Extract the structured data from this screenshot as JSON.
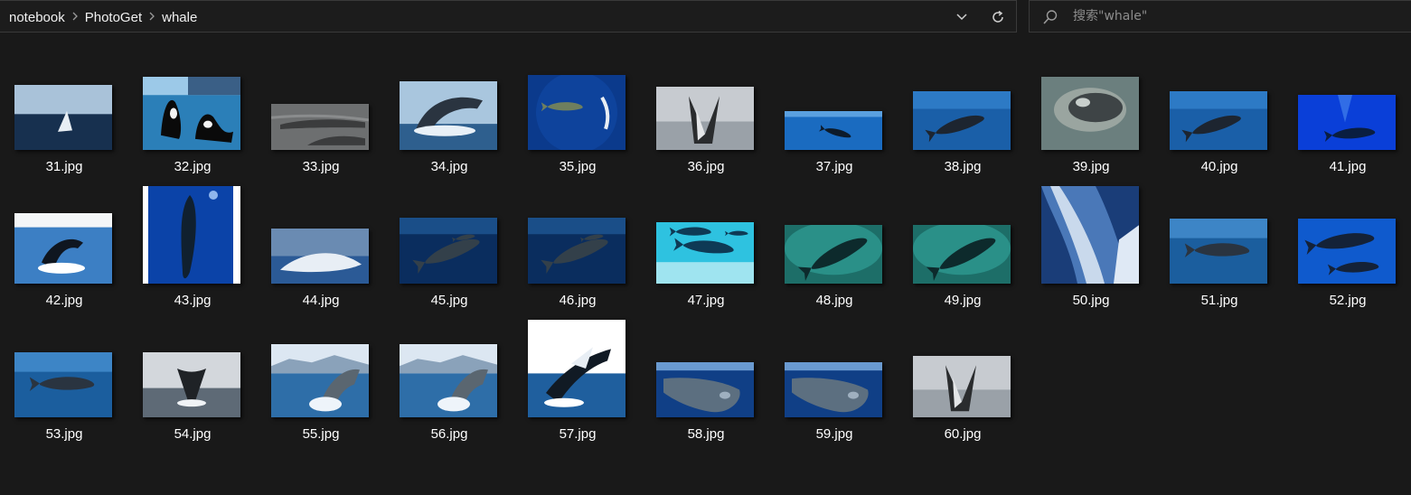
{
  "breadcrumb": [
    "notebook",
    "PhotoGet",
    "whale"
  ],
  "search": {
    "placeholder": "搜索\"whale\""
  },
  "icons": {
    "separator": "chevron-right-icon",
    "dropdown": "chevron-down-icon",
    "refresh": "refresh-icon",
    "search": "search-icon"
  },
  "files": [
    {
      "name": "31.jpg",
      "scene": "breach-sea",
      "w": 108,
      "h": 72
    },
    {
      "name": "32.jpg",
      "scene": "orca-pair",
      "w": 108,
      "h": 81
    },
    {
      "name": "33.jpg",
      "scene": "gray-backs",
      "w": 108,
      "h": 51
    },
    {
      "name": "34.jpg",
      "scene": "breach-splash",
      "w": 108,
      "h": 76
    },
    {
      "name": "35.jpg",
      "scene": "deep-blue-swim",
      "w": 108,
      "h": 83
    },
    {
      "name": "36.jpg",
      "scene": "lunge-gray",
      "w": 108,
      "h": 70
    },
    {
      "name": "37.jpg",
      "scene": "small-blue",
      "w": 108,
      "h": 43
    },
    {
      "name": "38.jpg",
      "scene": "pilot-blue",
      "w": 108,
      "h": 65
    },
    {
      "name": "39.jpg",
      "scene": "surface-gray",
      "w": 108,
      "h": 81
    },
    {
      "name": "40.jpg",
      "scene": "pilot-blue",
      "w": 108,
      "h": 65
    },
    {
      "name": "41.jpg",
      "scene": "bright-blue",
      "w": 108,
      "h": 61
    },
    {
      "name": "42.jpg",
      "scene": "breach-sky",
      "w": 108,
      "h": 78
    },
    {
      "name": "43.jpg",
      "scene": "vertical-dive",
      "w": 108,
      "h": 108
    },
    {
      "name": "44.jpg",
      "scene": "white-whale",
      "w": 108,
      "h": 61
    },
    {
      "name": "45.jpg",
      "scene": "humpback-dark",
      "w": 108,
      "h": 73
    },
    {
      "name": "46.jpg",
      "scene": "humpback-dark",
      "w": 108,
      "h": 73
    },
    {
      "name": "47.jpg",
      "scene": "cyan-pair",
      "w": 108,
      "h": 68
    },
    {
      "name": "48.jpg",
      "scene": "teal-whale",
      "w": 108,
      "h": 65
    },
    {
      "name": "49.jpg",
      "scene": "teal-whale",
      "w": 108,
      "h": 65
    },
    {
      "name": "50.jpg",
      "scene": "fin-closeup",
      "w": 108,
      "h": 108
    },
    {
      "name": "51.jpg",
      "scene": "humpback-light",
      "w": 108,
      "h": 72
    },
    {
      "name": "52.jpg",
      "scene": "pilot-two",
      "w": 108,
      "h": 72
    },
    {
      "name": "53.jpg",
      "scene": "humpback-light",
      "w": 108,
      "h": 72
    },
    {
      "name": "54.jpg",
      "scene": "tail-gray",
      "w": 108,
      "h": 72
    },
    {
      "name": "55.jpg",
      "scene": "breach-mountain",
      "w": 108,
      "h": 81
    },
    {
      "name": "56.jpg",
      "scene": "breach-mountain",
      "w": 108,
      "h": 81
    },
    {
      "name": "57.jpg",
      "scene": "breach-white",
      "w": 108,
      "h": 108
    },
    {
      "name": "58.jpg",
      "scene": "head-underwater",
      "w": 108,
      "h": 61
    },
    {
      "name": "59.jpg",
      "scene": "head-underwater",
      "w": 108,
      "h": 61
    },
    {
      "name": "60.jpg",
      "scene": "lunge-gray",
      "w": 108,
      "h": 68
    }
  ],
  "colors": {
    "background": "#191919",
    "border": "#3a3a3a",
    "text": "#ffffff",
    "placeholder": "#8c8c8c"
  }
}
